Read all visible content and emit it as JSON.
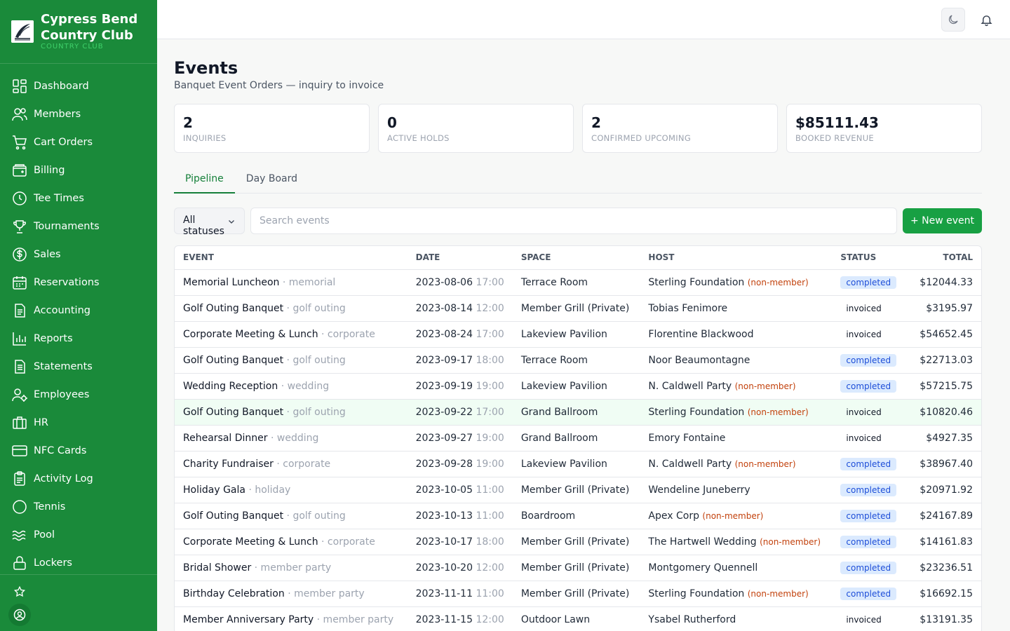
{
  "brand": {
    "name": "Cypress Bend Country Club",
    "subtitle": "COUNTRY CLUB"
  },
  "nav": [
    {
      "label": "Dashboard",
      "icon": "dashboard-icon"
    },
    {
      "label": "Members",
      "icon": "members-icon"
    },
    {
      "label": "Cart Orders",
      "icon": "cart-icon"
    },
    {
      "label": "Billing",
      "icon": "wallet-icon"
    },
    {
      "label": "Tee Times",
      "icon": "clock-icon"
    },
    {
      "label": "Tournaments",
      "icon": "trophy-icon"
    },
    {
      "label": "Sales",
      "icon": "dollar-icon"
    },
    {
      "label": "Reservations",
      "icon": "calendar-icon"
    },
    {
      "label": "Accounting",
      "icon": "document-icon"
    },
    {
      "label": "Reports",
      "icon": "bar-chart-icon"
    },
    {
      "label": "Statements",
      "icon": "statement-icon"
    },
    {
      "label": "Employees",
      "icon": "employee-icon"
    },
    {
      "label": "HR",
      "icon": "briefcase-icon"
    },
    {
      "label": "NFC Cards",
      "icon": "card-icon"
    },
    {
      "label": "Activity Log",
      "icon": "clipboard-icon"
    },
    {
      "label": "Tennis",
      "icon": "tennis-icon"
    },
    {
      "label": "Pool",
      "icon": "waves-icon"
    },
    {
      "label": "Lockers",
      "icon": "lock-icon"
    }
  ],
  "page": {
    "title": "Events",
    "subtitle": "Banquet Event Orders — inquiry to invoice"
  },
  "stats": [
    {
      "value": "2",
      "label": "INQUIRIES"
    },
    {
      "value": "0",
      "label": "ACTIVE HOLDS"
    },
    {
      "value": "2",
      "label": "CONFIRMED UPCOMING"
    },
    {
      "value": "$85111.43",
      "label": "BOOKED REVENUE"
    }
  ],
  "tabs": [
    {
      "label": "Pipeline",
      "active": true
    },
    {
      "label": "Day Board",
      "active": false
    }
  ],
  "toolbar": {
    "status_selected": "All statuses",
    "search_placeholder": "Search events",
    "search_value": "",
    "new_button": "+ New event"
  },
  "table": {
    "headers": {
      "event": "EVENT",
      "date": "DATE",
      "space": "SPACE",
      "host": "HOST",
      "status": "STATUS",
      "total": "TOTAL"
    },
    "rows": [
      {
        "name": "Memorial Luncheon",
        "type": "· memorial",
        "date": "2023-08-06",
        "time": "17:00",
        "space": "Terrace Room",
        "host": "Sterling Foundation",
        "host_tag": "(non-member)",
        "status": "completed",
        "total": "$12044.33"
      },
      {
        "name": "Golf Outing Banquet",
        "type": "· golf outing",
        "date": "2023-08-14",
        "time": "12:00",
        "space": "Member Grill (Private)",
        "host": "Tobias Fenimore",
        "host_tag": "",
        "status": "invoiced",
        "total": "$3195.97"
      },
      {
        "name": "Corporate Meeting & Lunch",
        "type": "· corporate",
        "date": "2023-08-24",
        "time": "17:00",
        "space": "Lakeview Pavilion",
        "host": "Florentine Blackwood",
        "host_tag": "",
        "status": "invoiced",
        "total": "$54652.45"
      },
      {
        "name": "Golf Outing Banquet",
        "type": "· golf outing",
        "date": "2023-09-17",
        "time": "18:00",
        "space": "Terrace Room",
        "host": "Noor Beaumontagne",
        "host_tag": "",
        "status": "completed",
        "total": "$22713.03"
      },
      {
        "name": "Wedding Reception",
        "type": "· wedding",
        "date": "2023-09-19",
        "time": "19:00",
        "space": "Lakeview Pavilion",
        "host": "N. Caldwell Party",
        "host_tag": "(non-member)",
        "status": "completed",
        "total": "$57215.75"
      },
      {
        "name": "Golf Outing Banquet",
        "type": "· golf outing",
        "date": "2023-09-22",
        "time": "17:00",
        "space": "Grand Ballroom",
        "host": "Sterling Foundation",
        "host_tag": "(non-member)",
        "status": "invoiced",
        "total": "$10820.46"
      },
      {
        "name": "Rehearsal Dinner",
        "type": "· wedding",
        "date": "2023-09-27",
        "time": "19:00",
        "space": "Grand Ballroom",
        "host": "Emory Fontaine",
        "host_tag": "",
        "status": "invoiced",
        "total": "$4927.35"
      },
      {
        "name": "Charity Fundraiser",
        "type": "· corporate",
        "date": "2023-09-28",
        "time": "19:00",
        "space": "Lakeview Pavilion",
        "host": "N. Caldwell Party",
        "host_tag": "(non-member)",
        "status": "completed",
        "total": "$38967.40"
      },
      {
        "name": "Holiday Gala",
        "type": "· holiday",
        "date": "2023-10-05",
        "time": "11:00",
        "space": "Member Grill (Private)",
        "host": "Wendeline Juneberry",
        "host_tag": "",
        "status": "completed",
        "total": "$20971.92"
      },
      {
        "name": "Golf Outing Banquet",
        "type": "· golf outing",
        "date": "2023-10-13",
        "time": "11:00",
        "space": "Boardroom",
        "host": "Apex Corp",
        "host_tag": "(non-member)",
        "status": "completed",
        "total": "$24167.89"
      },
      {
        "name": "Corporate Meeting & Lunch",
        "type": "· corporate",
        "date": "2023-10-17",
        "time": "18:00",
        "space": "Member Grill (Private)",
        "host": "The Hartwell Wedding",
        "host_tag": "(non-member)",
        "status": "completed",
        "total": "$14161.83"
      },
      {
        "name": "Bridal Shower",
        "type": "· member party",
        "date": "2023-10-20",
        "time": "12:00",
        "space": "Member Grill (Private)",
        "host": "Montgomery Quennell",
        "host_tag": "",
        "status": "completed",
        "total": "$23236.51"
      },
      {
        "name": "Birthday Celebration",
        "type": "· member party",
        "date": "2023-11-11",
        "time": "11:00",
        "space": "Member Grill (Private)",
        "host": "Sterling Foundation",
        "host_tag": "(non-member)",
        "status": "completed",
        "total": "$16692.15"
      },
      {
        "name": "Member Anniversary Party",
        "type": "· member party",
        "date": "2023-11-15",
        "time": "12:00",
        "space": "Outdoor Lawn",
        "host": "Ysabel Rutherford",
        "host_tag": "",
        "status": "invoiced",
        "total": "$13191.35"
      }
    ]
  },
  "colors": {
    "sidebar": "#1a8a3a",
    "accent": "#16803a",
    "primary_button": "#18a043",
    "badge_completed_bg": "#dbeafe",
    "non_member": "#c2410c"
  }
}
